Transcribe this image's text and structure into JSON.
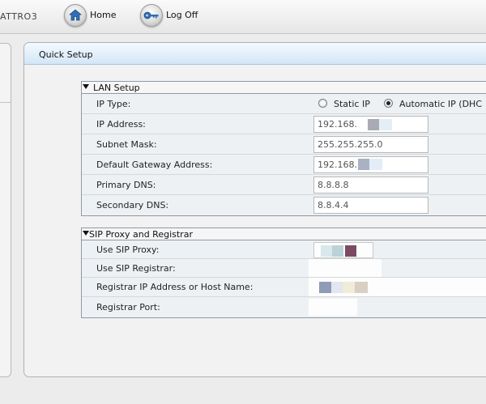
{
  "header": {
    "brand": "ATTRO3",
    "home_label": "Home",
    "logoff_label": "Log Off"
  },
  "main": {
    "title": "Quick Setup"
  },
  "lan": {
    "title": "LAN Setup",
    "ip_type_label": "IP Type:",
    "static_label": "Static IP",
    "auto_label": "Automatic IP (DHC",
    "selected": "Automatic IP",
    "ip_address_label": "IP Address:",
    "ip_address_value": "192.168.",
    "subnet_label": "Subnet Mask:",
    "subnet_value": "255.255.255.0",
    "gateway_label": "Default Gateway Address:",
    "gateway_value": "192.168.",
    "primary_dns_label": "Primary DNS:",
    "primary_dns_value": "8.8.8.8",
    "secondary_dns_label": "Secondary DNS:",
    "secondary_dns_value": "8.8.4.4"
  },
  "sip": {
    "title": "SIP Proxy and Registrar",
    "use_proxy_label": "Use SIP Proxy:",
    "use_registrar_label": "Use SIP Registrar:",
    "registrar_ip_label": "Registrar IP Address or Host Name:",
    "registrar_port_label": "Registrar Port:"
  },
  "colors": {
    "header_gradient_bottom": "#d3e6f6",
    "section_border": "#8e9aa6"
  }
}
